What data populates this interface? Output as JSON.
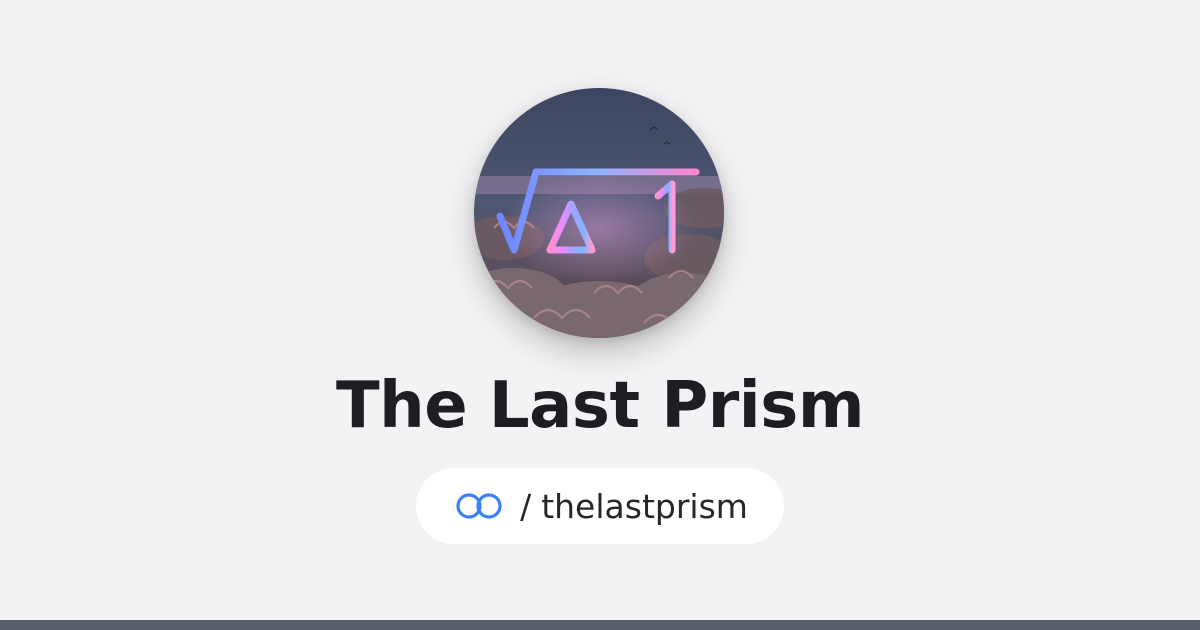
{
  "profile": {
    "name": "The Last Prism",
    "handle_separator": "/",
    "handle": "thelastprism",
    "avatar_formula": "√∆-1",
    "avatar_icon": "sqrt-delta-minus-one-logo"
  },
  "icons": {
    "link": "interlocked-rings-icon"
  },
  "colors": {
    "background": "#f3f3f5",
    "title_text": "#1e1e22",
    "pill_background": "#ffffff",
    "link_icon": "#3b82f6",
    "bottom_bar": "#58606a"
  }
}
